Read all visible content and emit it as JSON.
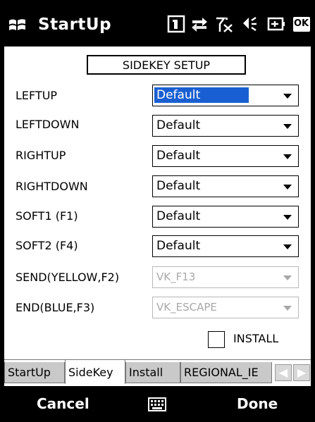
{
  "window": {
    "title": "StartUp",
    "ok_label": "OK",
    "tray_icons": [
      "sim-card-icon",
      "network-sync-icon",
      "signal-off-icon",
      "speaker-icon",
      "battery-plug-icon"
    ]
  },
  "page": {
    "header": "SIDEKEY SETUP",
    "rows": [
      {
        "label": "LEFTUP",
        "value": "Default",
        "selected": true,
        "enabled": true
      },
      {
        "label": "LEFTDOWN",
        "value": "Default",
        "selected": false,
        "enabled": true
      },
      {
        "label": "RIGHTUP",
        "value": "Default",
        "selected": false,
        "enabled": true
      },
      {
        "label": "RIGHTDOWN",
        "value": "Default",
        "selected": false,
        "enabled": true
      },
      {
        "label": "SOFT1 (F1)",
        "value": "Default",
        "selected": false,
        "enabled": true
      },
      {
        "label": "SOFT2 (F4)",
        "value": "Default",
        "selected": false,
        "enabled": true
      },
      {
        "label": "SEND(YELLOW,F2)",
        "value": "VK_F13",
        "selected": false,
        "enabled": false
      },
      {
        "label": "END(BLUE,F3)",
        "value": "VK_ESCAPE",
        "selected": false,
        "enabled": false
      }
    ],
    "install": {
      "label": "INSTALL",
      "checked": false
    }
  },
  "tabs": [
    {
      "label": "StartUp",
      "active": false
    },
    {
      "label": "SideKey",
      "active": true
    },
    {
      "label": "Install",
      "active": false
    },
    {
      "label": "REGIONAL_IE",
      "active": false
    }
  ],
  "tab_scroll": {
    "left_icon": "chevron-left-icon",
    "right_icon": "chevron-right-icon"
  },
  "softkeys": {
    "left": "Cancel",
    "right": "Done",
    "center_icon": "keyboard-icon"
  },
  "colors": {
    "selection": "#1a5fd1",
    "disabled_text": "#a8a8a8",
    "bar": "#000000"
  }
}
